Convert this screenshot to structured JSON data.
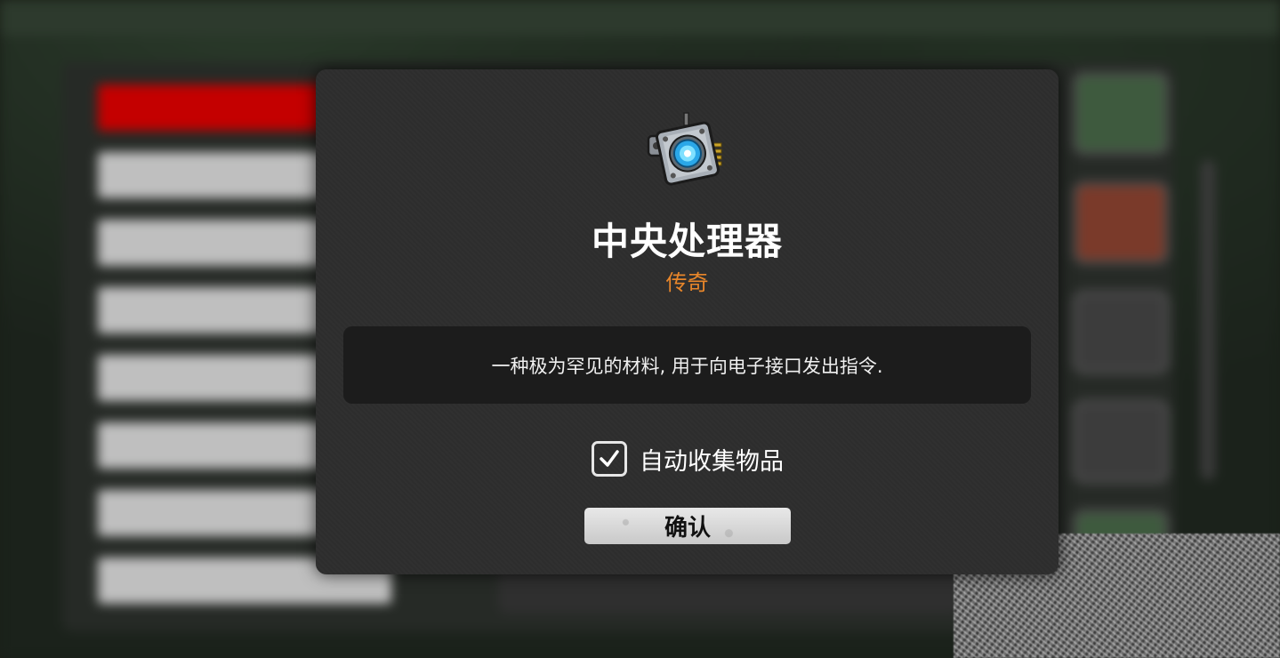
{
  "dialog": {
    "item_name": "中央处理器",
    "rarity": "传奇",
    "description": "一种极为罕见的材料, 用于向电子接口发出指令.",
    "auto_collect_label": "自动收集物品",
    "auto_collect_checked": true,
    "confirm_label": "确认",
    "item_icon": "cpu-chip-icon"
  },
  "colors": {
    "rarity_legendary": "#e8862a",
    "modal_bg": "#2d2d2d",
    "desc_bg": "#1c1c1c"
  }
}
